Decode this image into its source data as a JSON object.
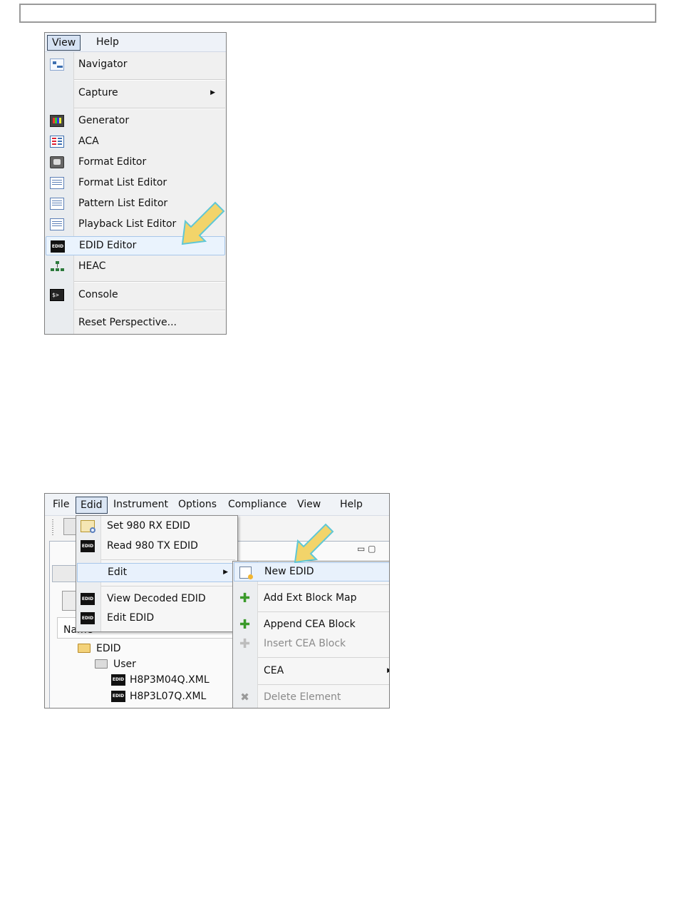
{
  "view_menu_shot": {
    "menubar": [
      "View",
      "Help"
    ],
    "items": [
      {
        "label": "Navigator",
        "icon": "navigator-icon"
      },
      {
        "label": "Capture",
        "icon": "",
        "submenu": true
      },
      {
        "label": "Generator",
        "icon": "generator-icon"
      },
      {
        "label": "ACA",
        "icon": "aca-icon"
      },
      {
        "label": "Format Editor",
        "icon": "format-editor-icon"
      },
      {
        "label": "Format List Editor",
        "icon": "list-icon"
      },
      {
        "label": "Pattern List Editor",
        "icon": "list-icon"
      },
      {
        "label": "Playback List Editor",
        "icon": "list-icon"
      },
      {
        "label": "EDID Editor",
        "icon": "edid-icon",
        "highlighted": true
      },
      {
        "label": "HEAC",
        "icon": "heac-icon"
      },
      {
        "label": "Console",
        "icon": "console-icon"
      },
      {
        "label": "Reset Perspective...",
        "icon": ""
      }
    ],
    "icon_text_edid": "EDID",
    "icon_text_console": "$>"
  },
  "edid_menu_shot": {
    "menubar": [
      "File",
      "Edid",
      "Instrument",
      "Options",
      "Compliance",
      "View",
      "Help"
    ],
    "edid_dropdown": [
      {
        "label": "Set 980 RX EDID"
      },
      {
        "label": "Read 980 TX EDID"
      },
      {
        "label": "Edit",
        "submenu": true,
        "selected": true
      },
      {
        "label": "View Decoded EDID"
      },
      {
        "label": "Edit EDID"
      }
    ],
    "edit_submenu": [
      {
        "label": "New EDID",
        "selected": true
      },
      {
        "label": "Add Ext Block Map"
      },
      {
        "label": "Append CEA Block"
      },
      {
        "label": "Insert CEA Block",
        "disabled": true
      },
      {
        "label": "CEA",
        "submenu": true
      },
      {
        "label": "Delete Element",
        "disabled": true
      }
    ],
    "tree_header": "Name",
    "tree": [
      {
        "label": "EDID",
        "type": "folder"
      },
      {
        "label": "User",
        "type": "folder"
      },
      {
        "label": "H8P3M04Q.XML",
        "type": "edid-file"
      },
      {
        "label": "H8P3L07Q.XML",
        "type": "edid-file"
      }
    ],
    "icon_text_edid": "EDID",
    "panel_controls": "▭ ▢"
  },
  "colors": {
    "arrow": "#f2d46a",
    "arrow_outline": "#5fc7d6",
    "highlight": "#eaf3fd"
  }
}
